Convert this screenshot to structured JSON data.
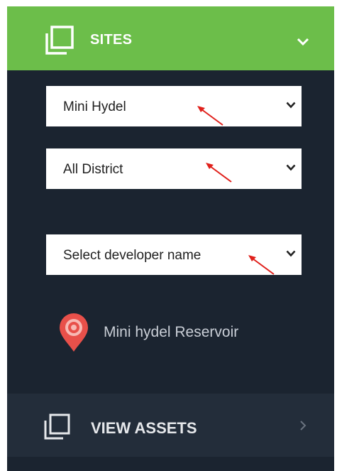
{
  "sidebar": {
    "sites": {
      "label": "SITES",
      "icon": "copy-square-icon",
      "expanded": true,
      "accent": "#6cbe4a"
    },
    "filters": {
      "category": {
        "value": "Mini Hydel",
        "icon": "chevron-down-icon"
      },
      "district": {
        "value": "All District",
        "icon": "chevron-down-icon"
      },
      "developer": {
        "placeholder": "Select developer name",
        "icon": "chevron-down-icon"
      }
    },
    "legend": {
      "label": "Mini hydel Reservoir",
      "icon": "map-pin-icon",
      "color": "#e8504a"
    },
    "view_assets": {
      "label": "VIEW ASSETS",
      "icon": "copy-square-icon"
    }
  },
  "annotations": {
    "arrow_color": "#e0201b"
  }
}
